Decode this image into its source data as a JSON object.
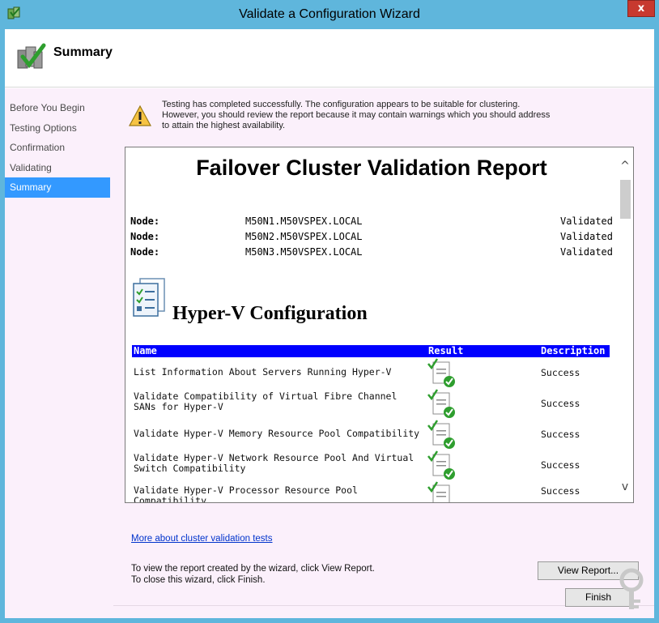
{
  "window": {
    "title": "Validate a Configuration Wizard",
    "close_label": "x"
  },
  "header": {
    "title": "Summary"
  },
  "nav": {
    "items": [
      {
        "label": "Before You Begin"
      },
      {
        "label": "Testing Options"
      },
      {
        "label": "Confirmation"
      },
      {
        "label": "Validating"
      },
      {
        "label": "Summary"
      }
    ]
  },
  "main": {
    "warning_line1": "Testing has completed successfully. The configuration appears to be suitable for clustering.",
    "warning_line2": "However, you should review the report because it may contain warnings which you should address",
    "warning_line3": "to attain the highest availability.",
    "report": {
      "title": "Failover Cluster Validation Report",
      "nodes": [
        {
          "label": "Node:",
          "name": "M50N1.M50VSPEX.LOCAL",
          "status": "Validated"
        },
        {
          "label": "Node:",
          "name": "M50N2.M50VSPEX.LOCAL",
          "status": "Validated"
        },
        {
          "label": "Node:",
          "name": "M50N3.M50VSPEX.LOCAL",
          "status": "Validated"
        }
      ],
      "section_title": "Hyper-V Configuration",
      "columns": {
        "name": "Name",
        "result": "Result",
        "description": "Description"
      },
      "rows": [
        {
          "name": "List Information About Servers Running Hyper-V",
          "description": "Success"
        },
        {
          "name": "Validate Compatibility of Virtual Fibre Channel SANs for Hyper-V",
          "description": "Success"
        },
        {
          "name": "Validate Hyper-V Memory Resource Pool Compatibility",
          "description": "Success"
        },
        {
          "name": "Validate Hyper-V Network Resource Pool And Virtual Switch Compatibility",
          "description": "Success"
        },
        {
          "name": "Validate Hyper-V Processor Resource Pool Compatibility",
          "description": "Success"
        }
      ]
    },
    "more_link": "More about cluster validation tests",
    "instr_line1": "To view the report created by the wizard, click View Report.",
    "instr_line2": "To close this wizard, click Finish.",
    "view_report_label": "View Report...",
    "finish_label": "Finish"
  }
}
